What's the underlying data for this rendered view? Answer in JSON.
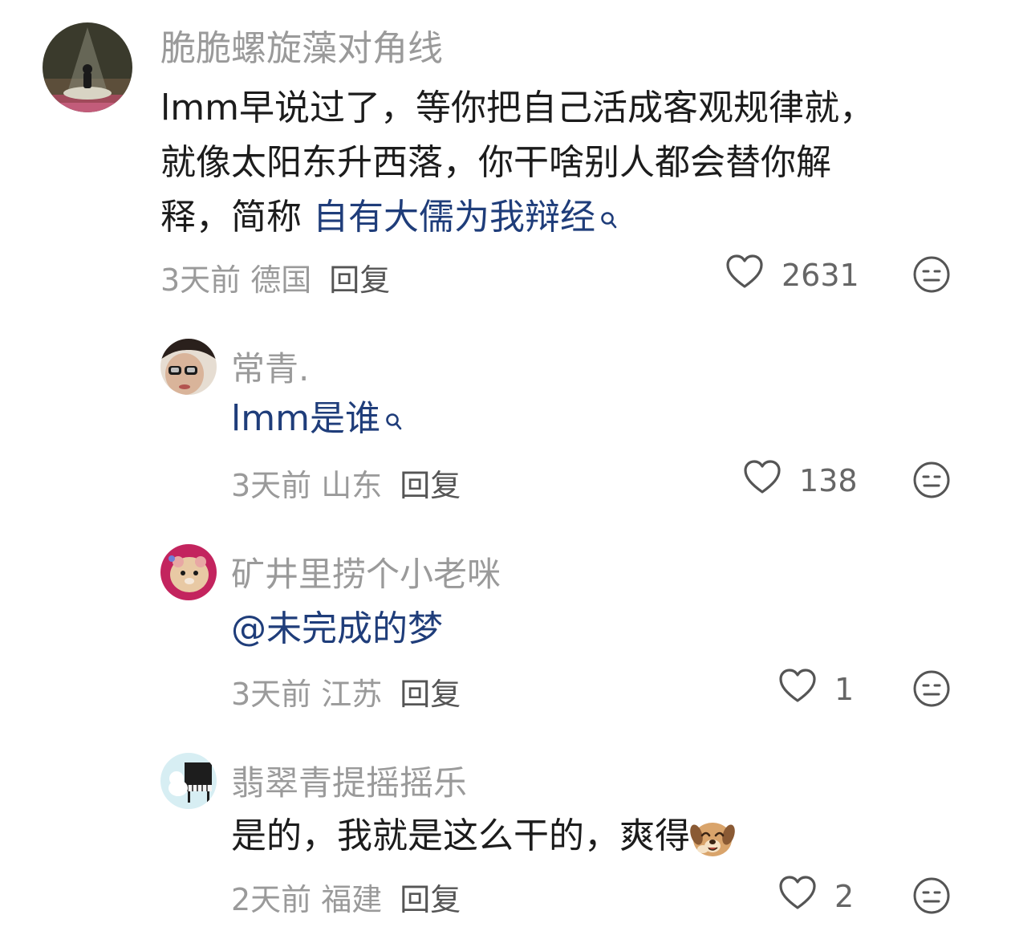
{
  "comments": [
    {
      "username": "脆脆螺旋藻对角线",
      "text_lines": [
        "lmm早说过了，等你把自己活成客观规律就，",
        "就像太阳东升西落，你干啥别人都会替你解"
      ],
      "text_prefix": "释，简称 ",
      "link_text": "自有大儒为我辩经",
      "time": "3天前",
      "location": "德国",
      "reply": "回复",
      "likes": "2631"
    },
    {
      "username": "常青.",
      "text_link": "lmm是谁",
      "time": "3天前",
      "location": "山东",
      "reply": "回复",
      "likes": "138"
    },
    {
      "username": "矿井里捞个小老咪",
      "text_link": "@未完成的梦",
      "time": "3天前",
      "location": "江苏",
      "reply": "回复",
      "likes": "1"
    },
    {
      "username": "翡翠青提摇摇乐",
      "text": "是的，我就是这么干的，爽得",
      "emoji": "laughing-dog-emoji",
      "time": "2天前",
      "location": "福建",
      "reply": "回复",
      "likes": "2"
    }
  ],
  "icons": {
    "like": "heart-outline-icon",
    "dislike": "neutral-face-icon",
    "search": "search-icon"
  },
  "colors": {
    "link": "#1f3d7a",
    "meta": "#9a9a9a",
    "text": "#1c1c1c"
  }
}
